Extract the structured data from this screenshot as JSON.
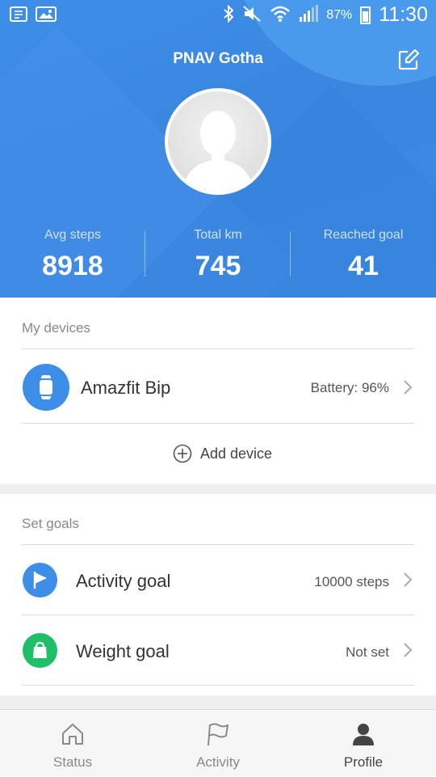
{
  "status_bar": {
    "battery_percent": "87%",
    "time": "11:30"
  },
  "header": {
    "title": "PNAV Gotha",
    "stats": [
      {
        "label": "Avg steps",
        "value": "8918"
      },
      {
        "label": "Total km",
        "value": "745"
      },
      {
        "label": "Reached goal",
        "value": "41"
      }
    ]
  },
  "devices": {
    "section_label": "My devices",
    "items": [
      {
        "name": "Amazfit Bip",
        "battery": "Battery: 96%"
      }
    ],
    "add_label": "Add device"
  },
  "goals": {
    "section_label": "Set goals",
    "items": [
      {
        "name": "Activity goal",
        "value": "10000 steps",
        "icon": "flag-icon",
        "color": "#3d8ee6"
      },
      {
        "name": "Weight goal",
        "value": "Not set",
        "icon": "weight-icon",
        "color": "#1fbf6a"
      }
    ]
  },
  "bottom_nav": {
    "items": [
      {
        "label": "Status",
        "icon": "home-icon",
        "active": false
      },
      {
        "label": "Activity",
        "icon": "flag-outline-icon",
        "active": false
      },
      {
        "label": "Profile",
        "icon": "person-icon",
        "active": true
      }
    ]
  },
  "colors": {
    "header_blue": "#3a86e0",
    "accent_green": "#1fbf6a"
  }
}
